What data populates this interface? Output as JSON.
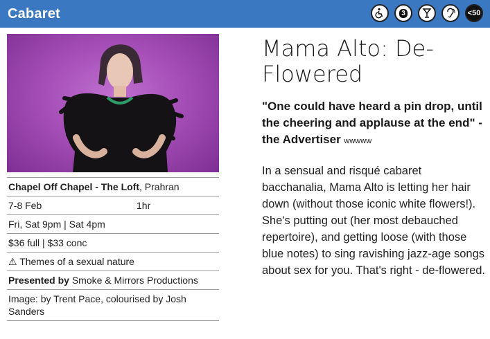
{
  "header": {
    "title": "Cabaret",
    "accessibility_icons": [
      "wheelchair-icon",
      "ticket-3-icon",
      "cocktail-icon",
      "hearing-icon",
      "under-50-icon"
    ],
    "icon_labels": {
      "ticket": "3",
      "under50": "<50"
    },
    "color": "#3a78c2"
  },
  "show": {
    "title": "Mama Alto: De-Flowered",
    "quote": "\"One could have heard a pin drop, until the cheering and applause at the end\" - the Advertiser",
    "quote_suffix": "wwwww",
    "description": "In a sensual and risqué cabaret bacchanalia, Mama Alto is letting her hair down (without those iconic white flowers!). She's putting out (her most debauched repertoire), and getting loose (with those blue notes) to sing ravishing jazz-age songs about sex for you. That's right - de-flowered."
  },
  "details": {
    "venue": "Chapel Off Chapel - The Loft",
    "suburb": ", Prahran",
    "dates": "7-8 Feb",
    "duration": "1hr",
    "times": "Fri, Sat 9pm | Sat 4pm",
    "prices": "$36 full | $33 conc",
    "warning": "⚠ Themes of a sexual nature",
    "presented_label": "Presented by",
    "presenter": " Smoke & Mirrors Productions",
    "image_credit": "Image: by Trent Pace, colourised by Josh Sanders"
  }
}
